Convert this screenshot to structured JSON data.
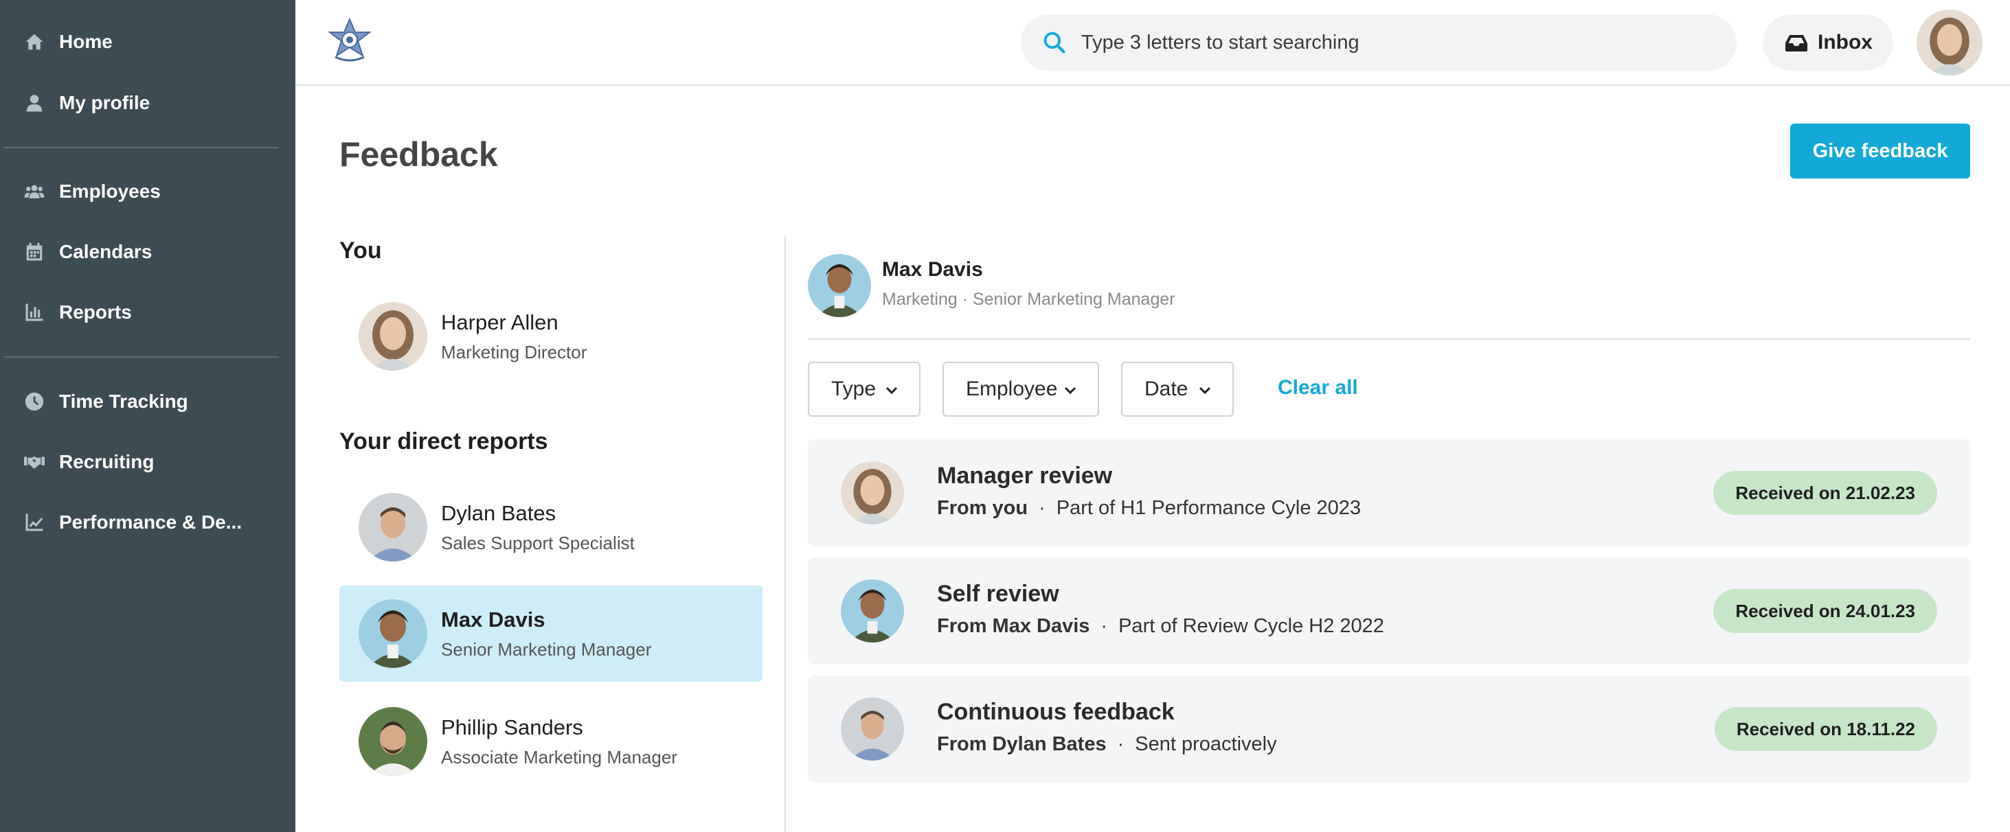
{
  "sidebar": {
    "items": [
      {
        "label": "Home",
        "icon": "home-icon"
      },
      {
        "label": "My profile",
        "icon": "user-icon"
      },
      {
        "label": "Employees",
        "icon": "users-icon"
      },
      {
        "label": "Calendars",
        "icon": "calendar-icon"
      },
      {
        "label": "Reports",
        "icon": "bar-chart-icon"
      },
      {
        "label": "Time Tracking",
        "icon": "clock-icon"
      },
      {
        "label": "Recruiting",
        "icon": "handshake-icon"
      },
      {
        "label": "Performance & De...",
        "icon": "line-chart-icon"
      }
    ]
  },
  "topbar": {
    "search_placeholder": "Type 3 letters to start searching",
    "inbox_label": "Inbox"
  },
  "page": {
    "title": "Feedback",
    "give_feedback_label": "Give feedback"
  },
  "you_section": {
    "title": "You",
    "person": {
      "name": "Harper Allen",
      "role": "Marketing Director"
    }
  },
  "reports_section": {
    "title": "Your direct reports",
    "people": [
      {
        "name": "Dylan Bates",
        "role": "Sales Support Specialist",
        "selected": false
      },
      {
        "name": "Max Davis",
        "role": "Senior Marketing Manager",
        "selected": true
      },
      {
        "name": "Phillip Sanders",
        "role": "Associate Marketing Manager",
        "selected": false
      }
    ]
  },
  "detail": {
    "name": "Max Davis",
    "subtitle": "Marketing · Senior Marketing Manager",
    "filters": {
      "type": "Type",
      "employee": "Employee",
      "date": "Date",
      "clear_all": "Clear all"
    },
    "cards": [
      {
        "title": "Manager review",
        "from": "From you",
        "context": "Part of H1 Performance Cyle 2023",
        "badge": "Received on 21.02.23"
      },
      {
        "title": "Self review",
        "from": "From Max Davis",
        "context": "Part of Review Cycle H2 2022",
        "badge": "Received on 24.01.23"
      },
      {
        "title": "Continuous feedback",
        "from": "From Dylan Bates",
        "context": "Sent proactively",
        "badge": "Received on 18.11.22"
      }
    ]
  },
  "colors": {
    "sidebar_bg": "#3c4c52",
    "accent": "#12a9d7",
    "selected_bg": "#cdeef8",
    "badge_bg": "#c7e6c8",
    "card_bg": "#f4f5f7"
  }
}
